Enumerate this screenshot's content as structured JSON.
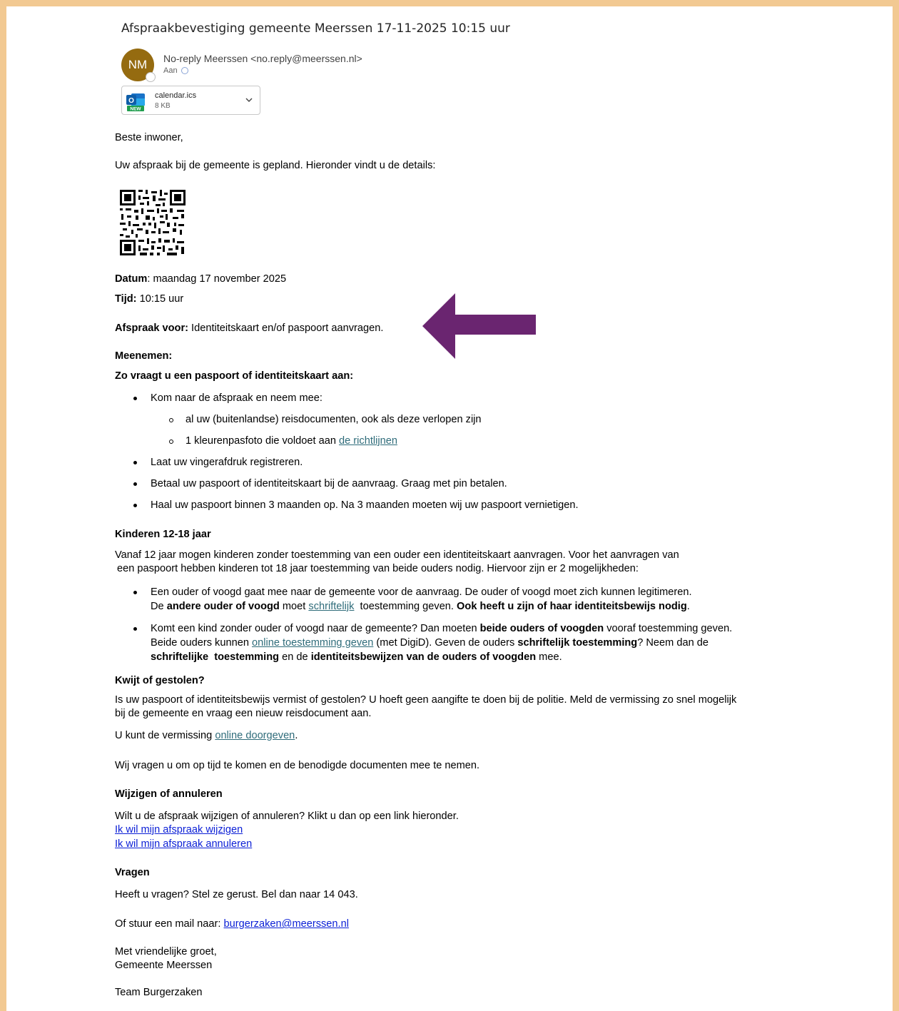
{
  "email": {
    "subject": "Afspraakbevestiging gemeente Meerssen 17-11-2025 10:15 uur",
    "avatar_initials": "NM",
    "avatar_color": "#956b10",
    "sender": "No-reply Meerssen <no.reply@meerssen.nl>",
    "to_label": "Aan",
    "attachment": {
      "name": "calendar.ics",
      "size": "8 KB",
      "badge": "NEW"
    }
  },
  "content": {
    "greeting": "Beste inwoner,",
    "intro": "Uw afspraak bij de gemeente is gepland. Hieronder vindt u de details:",
    "datum_label": "Datum",
    "datum_value": ": maandag 17 november 2025",
    "tijd_label": "Tijd:",
    "tijd_value": " 10:15 uur",
    "afspraak_label": "Afspraak voor:",
    "afspraak_value": " Identiteitskaart en/of paspoort aanvragen.",
    "meenemen_heading": "Meenemen:",
    "howto_heading": "Zo vraagt u een paspoort of identiteitskaart aan:",
    "bullet1": "Kom naar de afspraak en neem mee:",
    "sub1": "al uw (buitenlandse) reisdocumenten, ook als deze verlopen zijn",
    "sub2_prefix": "1 kleurenpasfoto die voldoet aan ",
    "sub2_link": "de richtlijnen",
    "bullet2": "Laat uw vingerafdruk registreren.",
    "bullet3": "Betaal uw paspoort of identiteitskaart bij de aanvraag. Graag met pin betalen.",
    "bullet4": "Haal uw paspoort binnen 3 maanden op. Na 3 maanden moeten wij uw paspoort vernietigen.",
    "kids_heading": "Kinderen 12-18 jaar",
    "kids_line1": "Vanaf 12 jaar mogen kinderen zonder toestemming van een ouder een identiteitskaart aanvragen. Voor het aanvragen van",
    "kids_line2": "een paspoort hebben kinderen tot 18 jaar toestemming van beide ouders nodig. Hiervoor zijn er 2 mogelijkheden:",
    "kb1_line1": "Een ouder of voogd gaat mee naar de gemeente voor de aanvraag. De ouder of voogd moet zich kunnen legitimeren.",
    "kb1_l2_a": "De ",
    "kb1_l2_b": "andere ouder of voogd",
    "kb1_l2_c": " moet ",
    "kb1_l2_link": "schriftelijk",
    "kb1_l2_d": "  toestemming geven. ",
    "kb1_l2_e": "Ook heeft u zijn of haar identiteitsbewijs nodig",
    "kb1_l2_f": ".",
    "kb2_l1_a": "Komt een kind zonder ouder of voogd naar de gemeente? Dan moeten ",
    "kb2_l1_b": "beide ouders of voogden",
    "kb2_l1_c": " vooraf toestemming geven.",
    "kb2_l2_a": "Beide ouders kunnen ",
    "kb2_l2_link": "online toestemming geven",
    "kb2_l2_b": " (met DigiD). Geven de ouders ",
    "kb2_l2_c": "schriftelijk toestemming",
    "kb2_l2_d": "? Neem dan de",
    "kb2_l3_a": "schriftelijke  toestemming",
    "kb2_l3_b": " en de ",
    "kb2_l3_c": "identiteitsbewijzen van de ouders of voogden",
    "kb2_l3_d": " mee.",
    "lost_heading": "Kwijt of gestolen?",
    "lost_line1": "Is uw paspoort of identiteitsbewijs vermist of gestolen? U hoeft geen aangifte te doen bij de politie. Meld de vermissing zo snel mogelijk",
    "lost_line2": "bij de gemeente en vraag een nieuw reisdocument aan.",
    "lost_online_prefix": "U kunt de vermissing ",
    "lost_online_link": "online doorgeven",
    "lost_online_suffix": ".",
    "ontime": "Wij vragen u om op tijd te komen en de benodigde documenten mee te nemen.",
    "change_heading": "Wijzigen of annuleren",
    "change_text": "Wilt u de afspraak wijzigen of annuleren? Klikt u dan op een link hieronder.",
    "change_link": "Ik wil mijn afspraak wijzigen",
    "cancel_link": "Ik wil mijn afspraak annuleren",
    "questions_heading": "Vragen",
    "questions_text": "Heeft u vragen? Stel ze gerust. Bel dan naar 14 043.",
    "mail_prefix": "Of stuur een mail naar: ",
    "mail_link": "burgerzaken@meerssen.nl",
    "regards": "Met vriendelijke groet,",
    "org": "Gemeente Meerssen",
    "team": "Team Burgerzaken"
  },
  "colors": {
    "frame": "#f2c992",
    "arrow": "#6a2570",
    "link_teal": "#2f6c7a",
    "link_blue": "#0b1fd6"
  }
}
